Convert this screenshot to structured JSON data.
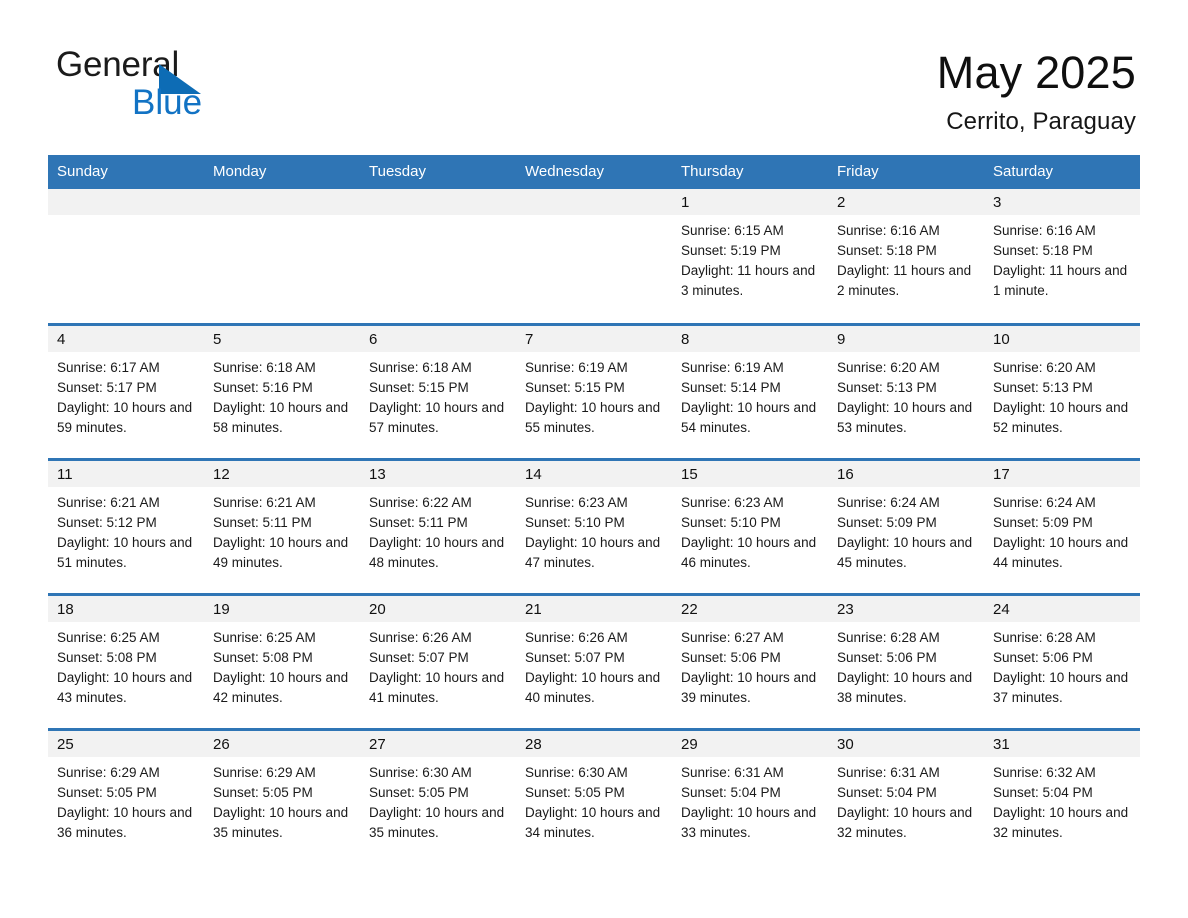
{
  "logo": {
    "word1": "General",
    "word2": "Blue",
    "triangle_color": "#0d6cb5",
    "word2_color": "#1273c4"
  },
  "header": {
    "title": "May 2025",
    "subtitle": "Cerrito, Paraguay"
  },
  "theme": {
    "header_blue": "#2f75b5",
    "daynum_band": "#f2f2f2",
    "text": "#1a1a1a"
  },
  "calendar": {
    "weekday_headers": [
      "Sunday",
      "Monday",
      "Tuesday",
      "Wednesday",
      "Thursday",
      "Friday",
      "Saturday"
    ],
    "labels": {
      "sunrise": "Sunrise:",
      "sunset": "Sunset:",
      "daylight": "Daylight:"
    },
    "weeks": [
      [
        {
          "day": "",
          "empty": true
        },
        {
          "day": "",
          "empty": true
        },
        {
          "day": "",
          "empty": true
        },
        {
          "day": "",
          "empty": true
        },
        {
          "day": "1",
          "sunrise": "Sunrise: 6:15 AM",
          "sunset": "Sunset: 5:19 PM",
          "daylight": "Daylight: 11 hours and 3 minutes."
        },
        {
          "day": "2",
          "sunrise": "Sunrise: 6:16 AM",
          "sunset": "Sunset: 5:18 PM",
          "daylight": "Daylight: 11 hours and 2 minutes."
        },
        {
          "day": "3",
          "sunrise": "Sunrise: 6:16 AM",
          "sunset": "Sunset: 5:18 PM",
          "daylight": "Daylight: 11 hours and 1 minute."
        }
      ],
      [
        {
          "day": "4",
          "sunrise": "Sunrise: 6:17 AM",
          "sunset": "Sunset: 5:17 PM",
          "daylight": "Daylight: 10 hours and 59 minutes."
        },
        {
          "day": "5",
          "sunrise": "Sunrise: 6:18 AM",
          "sunset": "Sunset: 5:16 PM",
          "daylight": "Daylight: 10 hours and 58 minutes."
        },
        {
          "day": "6",
          "sunrise": "Sunrise: 6:18 AM",
          "sunset": "Sunset: 5:15 PM",
          "daylight": "Daylight: 10 hours and 57 minutes."
        },
        {
          "day": "7",
          "sunrise": "Sunrise: 6:19 AM",
          "sunset": "Sunset: 5:15 PM",
          "daylight": "Daylight: 10 hours and 55 minutes."
        },
        {
          "day": "8",
          "sunrise": "Sunrise: 6:19 AM",
          "sunset": "Sunset: 5:14 PM",
          "daylight": "Daylight: 10 hours and 54 minutes."
        },
        {
          "day": "9",
          "sunrise": "Sunrise: 6:20 AM",
          "sunset": "Sunset: 5:13 PM",
          "daylight": "Daylight: 10 hours and 53 minutes."
        },
        {
          "day": "10",
          "sunrise": "Sunrise: 6:20 AM",
          "sunset": "Sunset: 5:13 PM",
          "daylight": "Daylight: 10 hours and 52 minutes."
        }
      ],
      [
        {
          "day": "11",
          "sunrise": "Sunrise: 6:21 AM",
          "sunset": "Sunset: 5:12 PM",
          "daylight": "Daylight: 10 hours and 51 minutes."
        },
        {
          "day": "12",
          "sunrise": "Sunrise: 6:21 AM",
          "sunset": "Sunset: 5:11 PM",
          "daylight": "Daylight: 10 hours and 49 minutes."
        },
        {
          "day": "13",
          "sunrise": "Sunrise: 6:22 AM",
          "sunset": "Sunset: 5:11 PM",
          "daylight": "Daylight: 10 hours and 48 minutes."
        },
        {
          "day": "14",
          "sunrise": "Sunrise: 6:23 AM",
          "sunset": "Sunset: 5:10 PM",
          "daylight": "Daylight: 10 hours and 47 minutes."
        },
        {
          "day": "15",
          "sunrise": "Sunrise: 6:23 AM",
          "sunset": "Sunset: 5:10 PM",
          "daylight": "Daylight: 10 hours and 46 minutes."
        },
        {
          "day": "16",
          "sunrise": "Sunrise: 6:24 AM",
          "sunset": "Sunset: 5:09 PM",
          "daylight": "Daylight: 10 hours and 45 minutes."
        },
        {
          "day": "17",
          "sunrise": "Sunrise: 6:24 AM",
          "sunset": "Sunset: 5:09 PM",
          "daylight": "Daylight: 10 hours and 44 minutes."
        }
      ],
      [
        {
          "day": "18",
          "sunrise": "Sunrise: 6:25 AM",
          "sunset": "Sunset: 5:08 PM",
          "daylight": "Daylight: 10 hours and 43 minutes."
        },
        {
          "day": "19",
          "sunrise": "Sunrise: 6:25 AM",
          "sunset": "Sunset: 5:08 PM",
          "daylight": "Daylight: 10 hours and 42 minutes."
        },
        {
          "day": "20",
          "sunrise": "Sunrise: 6:26 AM",
          "sunset": "Sunset: 5:07 PM",
          "daylight": "Daylight: 10 hours and 41 minutes."
        },
        {
          "day": "21",
          "sunrise": "Sunrise: 6:26 AM",
          "sunset": "Sunset: 5:07 PM",
          "daylight": "Daylight: 10 hours and 40 minutes."
        },
        {
          "day": "22",
          "sunrise": "Sunrise: 6:27 AM",
          "sunset": "Sunset: 5:06 PM",
          "daylight": "Daylight: 10 hours and 39 minutes."
        },
        {
          "day": "23",
          "sunrise": "Sunrise: 6:28 AM",
          "sunset": "Sunset: 5:06 PM",
          "daylight": "Daylight: 10 hours and 38 minutes."
        },
        {
          "day": "24",
          "sunrise": "Sunrise: 6:28 AM",
          "sunset": "Sunset: 5:06 PM",
          "daylight": "Daylight: 10 hours and 37 minutes."
        }
      ],
      [
        {
          "day": "25",
          "sunrise": "Sunrise: 6:29 AM",
          "sunset": "Sunset: 5:05 PM",
          "daylight": "Daylight: 10 hours and 36 minutes."
        },
        {
          "day": "26",
          "sunrise": "Sunrise: 6:29 AM",
          "sunset": "Sunset: 5:05 PM",
          "daylight": "Daylight: 10 hours and 35 minutes."
        },
        {
          "day": "27",
          "sunrise": "Sunrise: 6:30 AM",
          "sunset": "Sunset: 5:05 PM",
          "daylight": "Daylight: 10 hours and 35 minutes."
        },
        {
          "day": "28",
          "sunrise": "Sunrise: 6:30 AM",
          "sunset": "Sunset: 5:05 PM",
          "daylight": "Daylight: 10 hours and 34 minutes."
        },
        {
          "day": "29",
          "sunrise": "Sunrise: 6:31 AM",
          "sunset": "Sunset: 5:04 PM",
          "daylight": "Daylight: 10 hours and 33 minutes."
        },
        {
          "day": "30",
          "sunrise": "Sunrise: 6:31 AM",
          "sunset": "Sunset: 5:04 PM",
          "daylight": "Daylight: 10 hours and 32 minutes."
        },
        {
          "day": "31",
          "sunrise": "Sunrise: 6:32 AM",
          "sunset": "Sunset: 5:04 PM",
          "daylight": "Daylight: 10 hours and 32 minutes."
        }
      ]
    ]
  }
}
